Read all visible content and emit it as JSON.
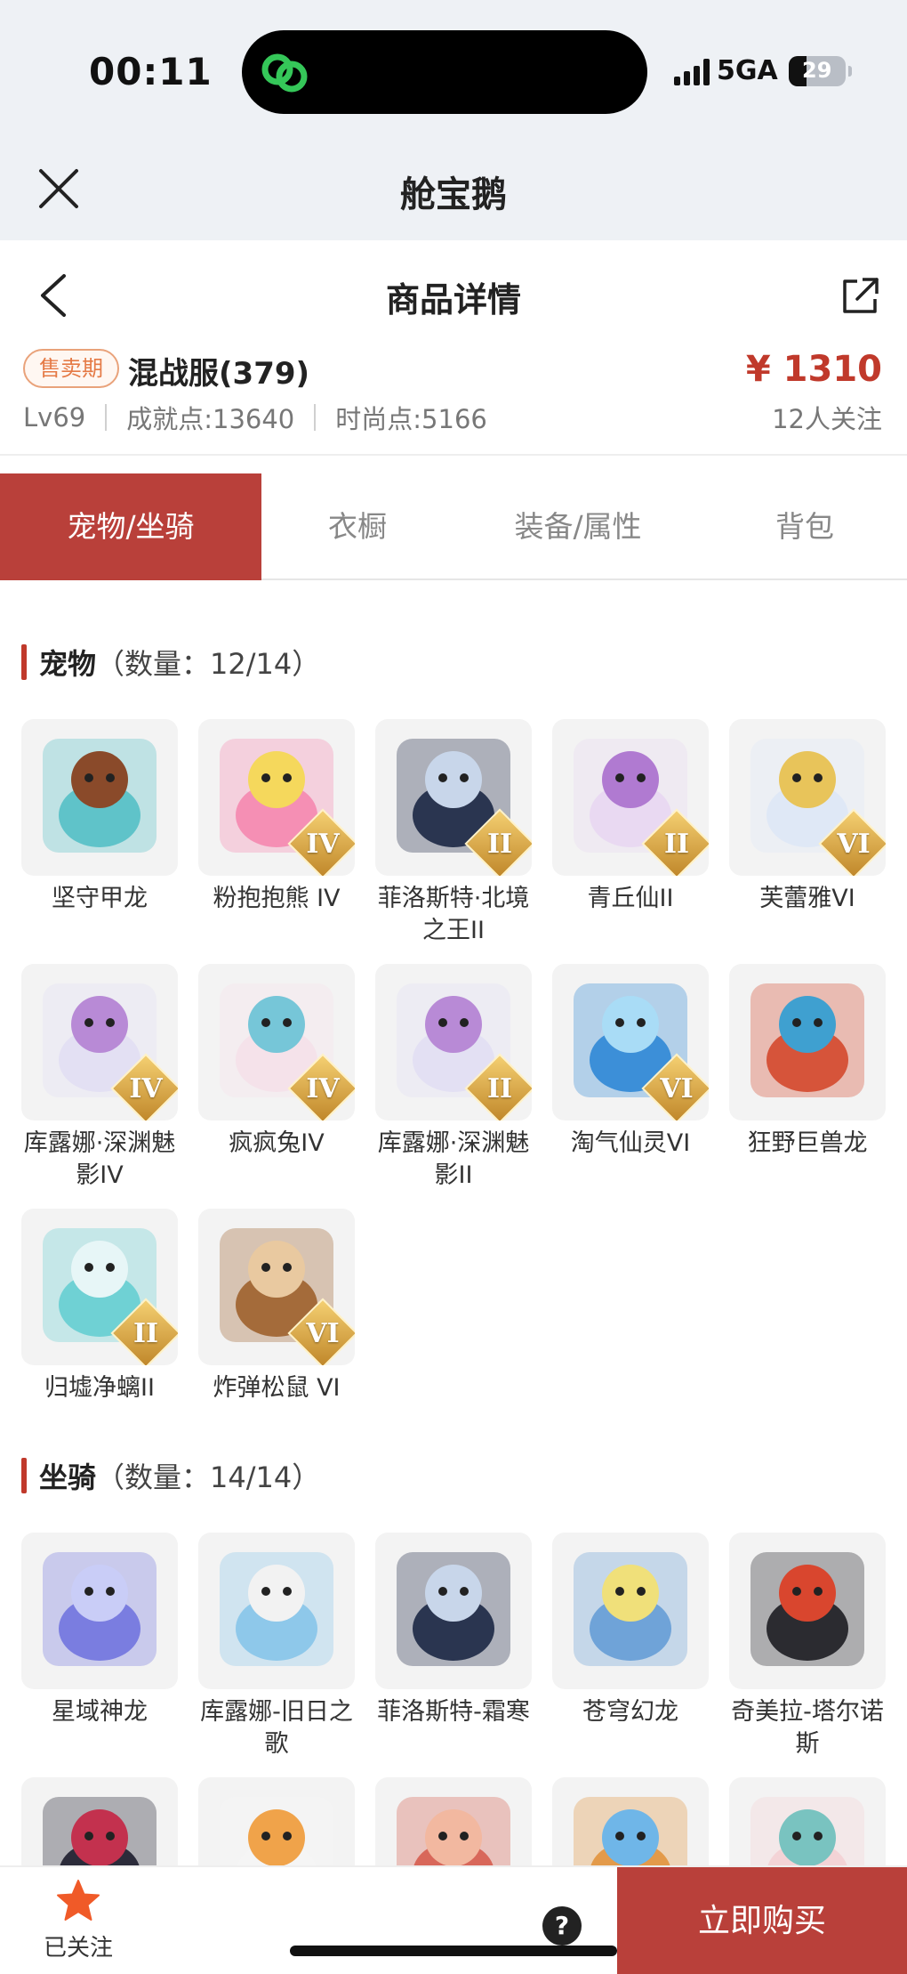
{
  "status": {
    "time": "00:11",
    "network": "5GA",
    "battery": "29"
  },
  "app": {
    "title": "舱宝鹅"
  },
  "page": {
    "title": "商品详情"
  },
  "product": {
    "badge": "售卖期",
    "server": "混战服(379)",
    "price": "¥ 1310",
    "level": "Lv69",
    "achievement": "成就点:13640",
    "fashion": "时尚点:5166",
    "followers": "12人关注"
  },
  "tabs": [
    {
      "label": "宠物/坐骑",
      "active": true
    },
    {
      "label": "衣橱"
    },
    {
      "label": "装备/属性"
    },
    {
      "label": "背包"
    }
  ],
  "pets": {
    "name": "宠物",
    "count": "（数量：12/14）",
    "items": [
      {
        "name": "坚守甲龙",
        "rank": "",
        "icon": "armored-dragon-icon"
      },
      {
        "name": "粉抱抱熊 IV",
        "rank": "IV",
        "icon": "pink-bear-icon"
      },
      {
        "name": "菲洛斯特·北境之王II",
        "rank": "II",
        "icon": "ice-king-icon"
      },
      {
        "name": "青丘仙II",
        "rank": "II",
        "icon": "fox-fairy-icon"
      },
      {
        "name": "芙蕾雅VI",
        "rank": "VI",
        "icon": "freya-icon"
      },
      {
        "name": "库露娜·深渊魅影IV",
        "rank": "IV",
        "icon": "kuluna-abyss-icon"
      },
      {
        "name": "疯疯兔IV",
        "rank": "IV",
        "icon": "crazy-rabbit-icon"
      },
      {
        "name": "库露娜·深渊魅影II",
        "rank": "II",
        "icon": "kuluna-abyss-icon"
      },
      {
        "name": "淘气仙灵VI",
        "rank": "VI",
        "icon": "naughty-sprite-icon"
      },
      {
        "name": "狂野巨兽龙",
        "rank": "",
        "icon": "wild-beast-dragon-icon"
      },
      {
        "name": "归墟净螭II",
        "rank": "II",
        "icon": "water-dragon-icon"
      },
      {
        "name": "炸弹松鼠 VI",
        "rank": "VI",
        "icon": "bomb-squirrel-icon"
      }
    ]
  },
  "mounts": {
    "name": "坐骑",
    "count": "（数量：14/14）",
    "items": [
      {
        "name": "星域神龙",
        "icon": "star-dragon-icon"
      },
      {
        "name": "库露娜-旧日之歌",
        "icon": "kuluna-song-icon"
      },
      {
        "name": "菲洛斯特-霜寒",
        "icon": "frost-king-icon"
      },
      {
        "name": "苍穹幻龙",
        "icon": "sky-dragon-icon"
      },
      {
        "name": "奇美拉-塔尔诺斯",
        "icon": "chimera-icon"
      },
      {
        "name": "",
        "icon": "dark-dragon-icon"
      },
      {
        "name": "",
        "icon": "flame-arch-icon"
      },
      {
        "name": "",
        "icon": "red-lizard-icon"
      },
      {
        "name": "",
        "icon": "pilot-dog-icon"
      },
      {
        "name": "",
        "icon": "lion-dance-icon"
      }
    ]
  },
  "bottom": {
    "follow_label": "已关注",
    "help": "?",
    "buy_label": "立即购买"
  },
  "colors": {
    "accent": "#b9403a",
    "price": "#c0392b",
    "badge": "#e57a46",
    "star": "#f05a28"
  }
}
